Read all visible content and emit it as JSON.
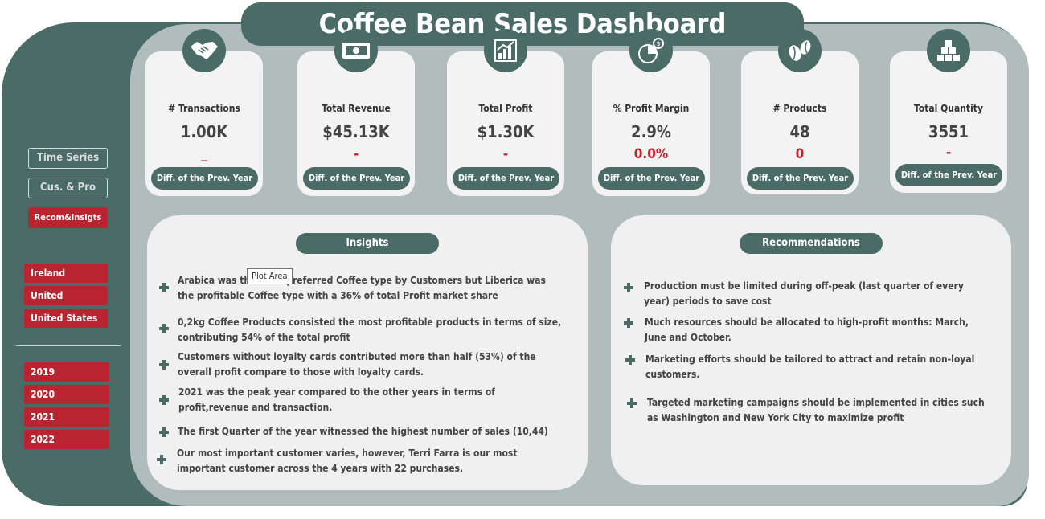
{
  "title": "Coffee Bean Sales Dashboard",
  "nav": [
    {
      "label": "Time Series",
      "active": false
    },
    {
      "label": "Cus. & Pro",
      "active": false
    },
    {
      "label": "Recom&Insigts",
      "active": true
    }
  ],
  "countries": [
    "Ireland",
    "United Kingdom",
    "United States"
  ],
  "years": [
    "2019",
    "2020",
    "2021",
    "2022"
  ],
  "kpis": [
    {
      "label": "# Transactions",
      "value": "1.00K",
      "diff": "_",
      "pill": "Diff. of the Prev. Year",
      "icon": "handshake-icon"
    },
    {
      "label": "Total Revenue",
      "value": "$45.13K",
      "diff": "-",
      "pill": "Diff. of the Prev. Year",
      "icon": "money-icon"
    },
    {
      "label": "Total Profit",
      "value": "$1.30K",
      "diff": "-",
      "pill": "Diff. of the Prev. Year",
      "icon": "bar-chart-icon"
    },
    {
      "label": "% Profit Margin",
      "value": "2.9%",
      "diff": "0.0%",
      "pill": "Diff. of the Prev. Year",
      "icon": "profit-margin-icon"
    },
    {
      "label": "# Products",
      "value": "48",
      "diff": "0",
      "pill": "Diff. of the Prev. Year",
      "icon": "coffee-beans-icon"
    },
    {
      "label": "Total Quantity",
      "value": "3551",
      "diff": "-",
      "pill": "Diff. of the Prev. Year",
      "icon": "boxes-icon"
    }
  ],
  "insights": {
    "title": "Insights",
    "items": [
      "Arabica was the most preferred Coffee type by Customers but Liberica was the profitable Coffee type with a 36%  of total Profit market share",
      "0,2kg Coffee Products consisted the most profitable products in terms of size, contributing 54% of the total profit",
      "Customers without loyalty cards contributed more than half (53%) of the overall profit compare to those with loyalty cards.",
      "2021 was the peak year compared to the other years in terms of profit,revenue and transaction.",
      "The first Quarter of the year witnessed the highest number of sales (10,44)",
      " Our most important customer varies, however, Terri Farra is our most important customer across the 4 years with 22 purchases."
    ]
  },
  "recommendations": {
    "title": "Recommendations",
    "items": [
      "Production must be limited during off-peak (last quarter of every year) periods to save cost",
      "Much resources should be allocated to high-profit months: March, June and October.",
      "Marketing efforts should be tailored to attract  and retain non-loyal customers.",
      "Targeted marketing campaigns should be  implemented in cities such as Washington and New York City to maximize profit"
    ]
  },
  "tooltip": "Plot Area",
  "colors": {
    "primary": "#4a6b66",
    "accent": "#b8242f",
    "panel": "#f0f0f0",
    "frame": "#b1bcbd"
  }
}
